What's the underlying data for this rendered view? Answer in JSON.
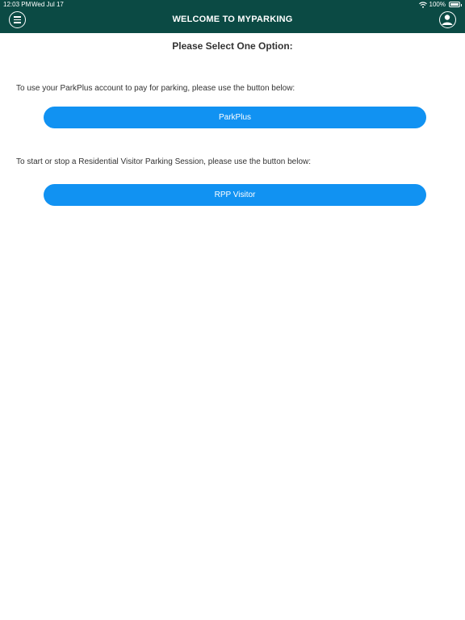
{
  "status_bar": {
    "time": "12:03 PM",
    "date": "Wed Jul 17",
    "battery": "100%",
    "wifi_icon": "wifi-icon",
    "battery_icon": "battery-icon"
  },
  "header": {
    "title": "WELCOME TO MYPARKING",
    "menu_icon": "hamburger-menu-icon",
    "profile_icon": "user-profile-icon",
    "background_color": "#0b4a44"
  },
  "main": {
    "heading": "Please Select One Option:",
    "parkplus_instruction": "To use your ParkPlus account to pay for parking, please use the button below:",
    "parkplus_button": "ParkPlus",
    "rpp_instruction": "To start or stop a Residential Visitor Parking Session, please use the button below:",
    "rpp_button": "RPP Visitor",
    "button_color": "#1192f2"
  }
}
